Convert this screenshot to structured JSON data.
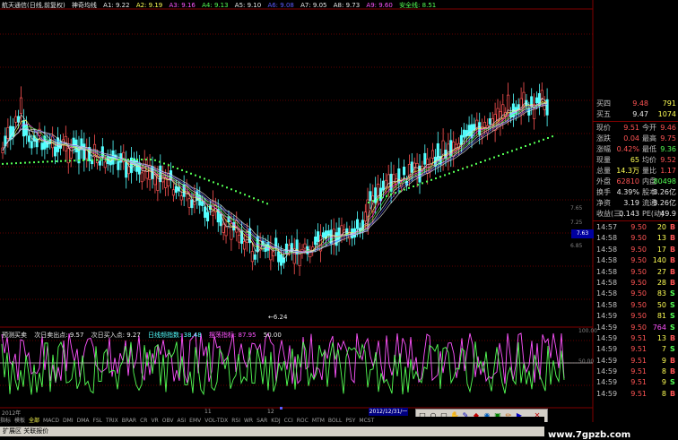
{
  "legend": {
    "title": "航天通信(日线,前复权)",
    "indicator_name": "神奇均线",
    "items": [
      {
        "text": "A1: 9.22",
        "color": "white"
      },
      {
        "text": "A2: 9.19",
        "color": "yellow"
      },
      {
        "text": "A3: 9.16",
        "color": "mag"
      },
      {
        "text": "A4: 9.13",
        "color": "green"
      },
      {
        "text": "A5: 9.10",
        "color": "white"
      },
      {
        "text": "A6: 9.08",
        "color": "blue"
      },
      {
        "text": "A7: 9.05",
        "color": "white"
      },
      {
        "text": "A8: 9.73",
        "color": "white"
      },
      {
        "text": "A9: 9.60",
        "color": "mag"
      },
      {
        "text": "安全线: 8.51",
        "color": "green"
      }
    ]
  },
  "indicator_legend": {
    "name": "预测买卖",
    "items": [
      {
        "text": "次日卖出点: 9.57",
        "color": "white"
      },
      {
        "text": "次日买入点: 9.27",
        "color": "white"
      },
      {
        "text": "日线频指数: 38.48",
        "color": "cyan"
      },
      {
        "text": "摆荡指标: 87.95",
        "color": "mag"
      },
      {
        "text": "50.00",
        "color": "white"
      }
    ]
  },
  "low_label": "←6.24",
  "price_axis": [
    "7.65",
    "7.25",
    "6.85"
  ],
  "indicator_axis": [
    "100.00",
    "50.00"
  ],
  "current_price_box": "7.63",
  "quote": {
    "rows": [
      {
        "l1": "买四",
        "v1": "9.48",
        "c1": "red",
        "v2": "791",
        "c2": "yellow"
      },
      {
        "l1": "买五",
        "v1": "9.47",
        "c1": "white",
        "v2": "1074",
        "c2": "yellow"
      }
    ],
    "stats": [
      {
        "l1": "现价",
        "v1": "9.51",
        "c1": "red",
        "l2": "今开",
        "v2": "9.46",
        "c2": "red"
      },
      {
        "l1": "涨跌",
        "v1": "0.04",
        "c1": "red",
        "l2": "最高",
        "v2": "9.75",
        "c2": "red"
      },
      {
        "l1": "涨幅",
        "v1": "0.42%",
        "c1": "red",
        "l2": "最低",
        "v2": "9.36",
        "c2": "green"
      },
      {
        "l1": "现量",
        "v1": "65",
        "c1": "yellow",
        "l2": "均价",
        "v2": "9.52",
        "c2": "red"
      },
      {
        "l1": "总量",
        "v1": "14.3万",
        "c1": "yellow",
        "l2": "量比",
        "v2": "1.17",
        "c2": "red"
      },
      {
        "l1": "外盘",
        "v1": "62810",
        "c1": "red",
        "l2": "内盘",
        "v2": "80498",
        "c2": "green"
      },
      {
        "l1": "换手",
        "v1": "4.39%",
        "c1": "white",
        "l2": "股本",
        "v2": "3.26亿",
        "c2": "white"
      },
      {
        "l1": "净资",
        "v1": "3.19",
        "c1": "white",
        "l2": "流通",
        "v2": "3.26亿",
        "c2": "white"
      },
      {
        "l1": "收益(三)",
        "v1": "0.143",
        "c1": "white",
        "l2": "PE(动)",
        "v2": "49.9",
        "c2": "white"
      }
    ],
    "ticks": [
      {
        "t": "14:57",
        "p": "9.50",
        "v": "20",
        "d": "B"
      },
      {
        "t": "14:58",
        "p": "9.50",
        "v": "13",
        "d": "B"
      },
      {
        "t": "14:58",
        "p": "9.50",
        "v": "17",
        "d": "B"
      },
      {
        "t": "14:58",
        "p": "9.50",
        "v": "140",
        "d": "B"
      },
      {
        "t": "14:58",
        "p": "9.50",
        "v": "27",
        "d": "B"
      },
      {
        "t": "14:58",
        "p": "9.50",
        "v": "28",
        "d": "B"
      },
      {
        "t": "14:58",
        "p": "9.50",
        "v": "83",
        "d": "S"
      },
      {
        "t": "14:58",
        "p": "9.50",
        "v": "50",
        "d": "S"
      },
      {
        "t": "14:59",
        "p": "9.50",
        "v": "81",
        "d": "S"
      },
      {
        "t": "14:59",
        "p": "9.50",
        "v": "764",
        "d": "S"
      },
      {
        "t": "14:59",
        "p": "9.51",
        "v": "13",
        "d": "B"
      },
      {
        "t": "14:59",
        "p": "9.51",
        "v": "7",
        "d": "S"
      },
      {
        "t": "14:59",
        "p": "9.51",
        "v": "9",
        "d": "B"
      },
      {
        "t": "14:59",
        "p": "9.51",
        "v": "8",
        "d": "B"
      },
      {
        "t": "14:59",
        "p": "9.51",
        "v": "9",
        "d": "S"
      },
      {
        "t": "14:59",
        "p": "9.51",
        "v": "8",
        "d": "B"
      }
    ]
  },
  "date_label": "2012/12/31/一",
  "x_axis_labels": [
    "2012年",
    "11",
    "12"
  ],
  "tabs": [
    "指标",
    "模板",
    "全部",
    "MACD",
    "DMI",
    "DMA",
    "FSL",
    "TRIX",
    "BRAR",
    "CR",
    "VR",
    "OBV",
    "ASI",
    "EMV",
    "VOL-TDX",
    "RSI",
    "WR",
    "SAR",
    "KDJ",
    "CCI",
    "ROC",
    "MTM",
    "BOLL",
    "PSY",
    "MCST"
  ],
  "active_tab": "全部",
  "status": "扩展区  关联报价",
  "watermark": "www.7gpzb.com",
  "toolbar_icons": [
    "square-icon",
    "circle-icon",
    "polygon-icon",
    "hand-icon",
    "pen-icon",
    "color-icon",
    "globe-icon",
    "image-icon",
    "pencil-icon",
    "close-icon"
  ]
}
